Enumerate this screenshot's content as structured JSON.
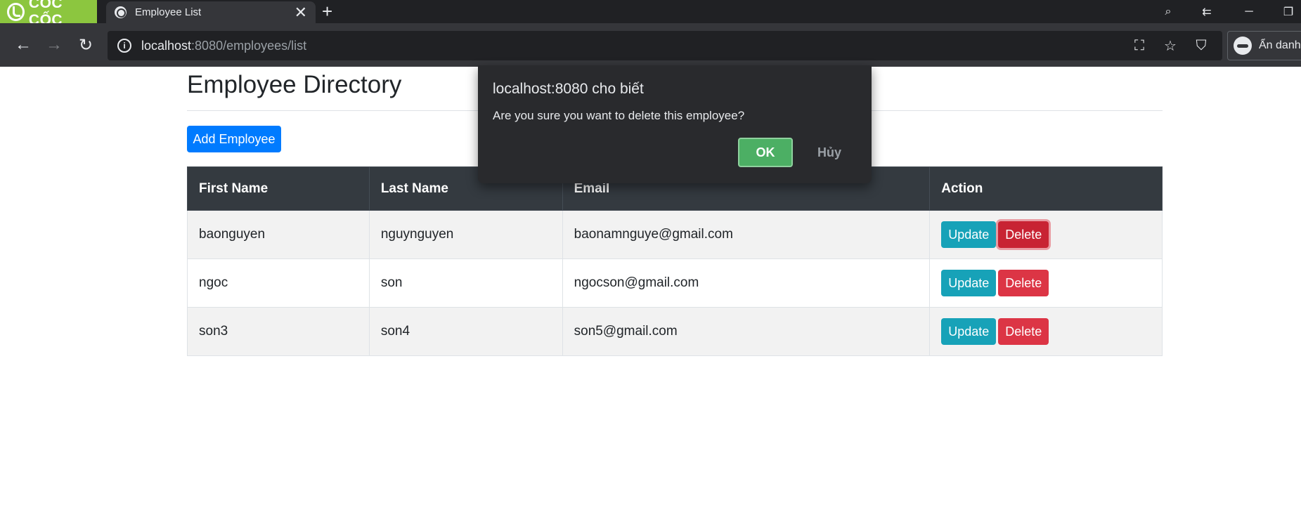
{
  "browser": {
    "brand": "CỐC CỐC",
    "tab_title": "Employee List",
    "url_host": "localhost",
    "url_path": ":8080/employees/list",
    "profile_label": "Ẩn danh"
  },
  "page": {
    "heading": "Employee Directory",
    "add_button": "Add Employee",
    "table": {
      "headers": [
        "First Name",
        "Last Name",
        "Email",
        "Action"
      ],
      "rows": [
        {
          "first": "baonguyen",
          "last": "nguynguyen",
          "email": "baonamnguye@gmail.com",
          "update": "Update",
          "delete": "Delete"
        },
        {
          "first": "ngoc",
          "last": "son",
          "email": "ngocson@gmail.com",
          "update": "Update",
          "delete": "Delete"
        },
        {
          "first": "son3",
          "last": "son4",
          "email": "son5@gmail.com",
          "update": "Update",
          "delete": "Delete"
        }
      ]
    }
  },
  "dialog": {
    "title": "localhost:8080 cho biết",
    "message": "Are you sure you want to delete this employee?",
    "ok": "OK",
    "cancel": "Hủy"
  },
  "colors": {
    "primary": "#007bff",
    "info": "#17a2b8",
    "danger": "#dc3545",
    "table_header": "#343a40",
    "dialog_bg": "#292a2d",
    "dialog_ok": "#4caf64",
    "brand_green": "#8cc63f"
  }
}
